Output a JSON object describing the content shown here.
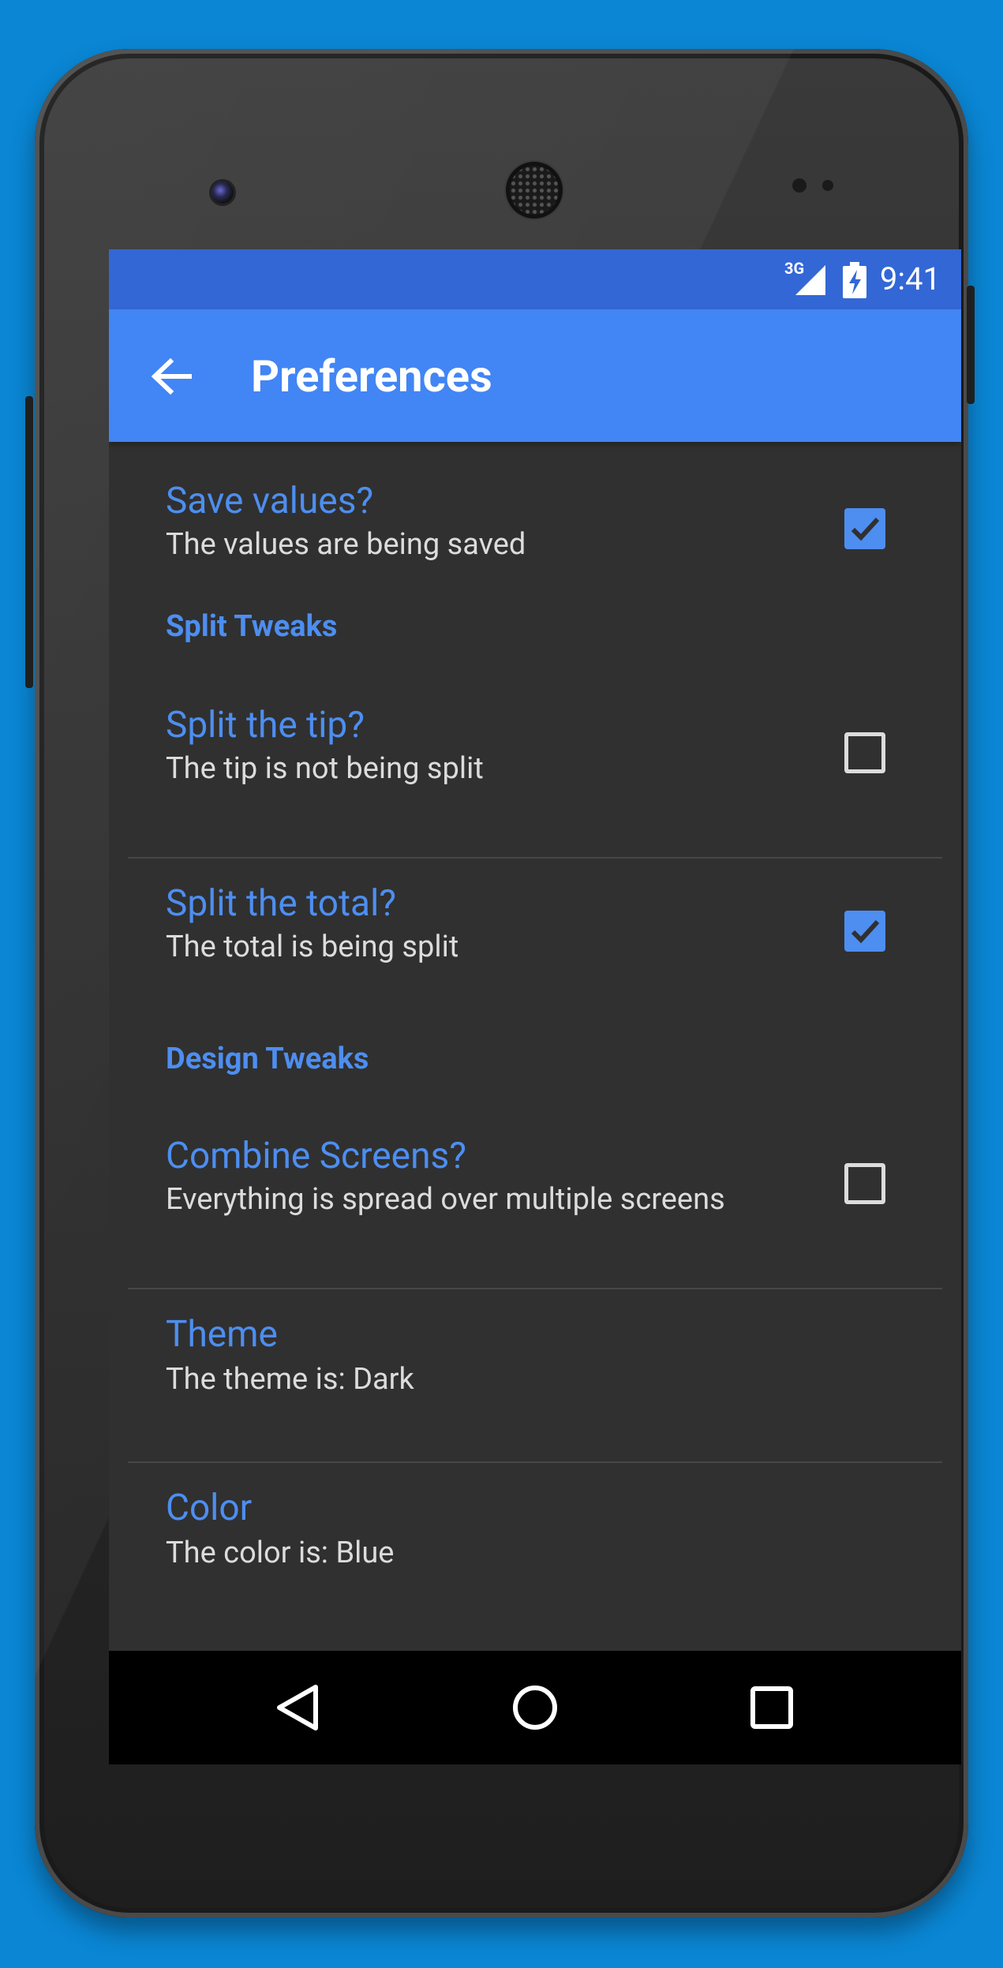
{
  "statusbar": {
    "network": "3G",
    "time": "9:41"
  },
  "appbar": {
    "title": "Preferences",
    "back_icon": "arrow-left-icon"
  },
  "preferences": {
    "save_values": {
      "title": "Save values?",
      "summary": "The values are being saved",
      "checked": true
    },
    "split_category": "Split Tweaks",
    "split_tip": {
      "title": "Split the tip?",
      "summary": "The tip is not being split",
      "checked": false
    },
    "split_total": {
      "title": "Split the total?",
      "summary": "The total is being split",
      "checked": true
    },
    "design_category": "Design Tweaks",
    "combine_screens": {
      "title": "Combine Screens?",
      "summary": "Everything is spread over multiple screens",
      "checked": false
    },
    "theme": {
      "title": "Theme",
      "summary": "The theme is: Dark"
    },
    "color": {
      "title": "Color",
      "summary": "The color is: Blue"
    }
  },
  "navbar": {
    "back": "back-triangle-icon",
    "home": "home-circle-icon",
    "recents": "recents-square-icon"
  },
  "colors": {
    "background": "#0a86d4",
    "statusbar": "#3367d6",
    "appbar": "#4285f4",
    "accent": "#4d8ef0",
    "screen": "#303030"
  }
}
